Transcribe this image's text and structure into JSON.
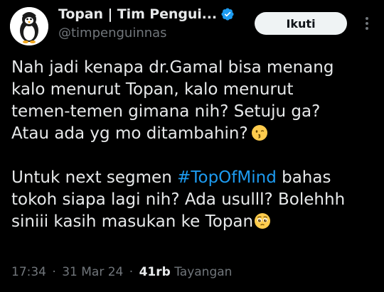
{
  "header": {
    "display_name": "Topan | Tim Pengui...",
    "handle": "@timpenguinnas",
    "follow_label": "Ikuti"
  },
  "tweet": {
    "para1_line1": "Nah jadi kenapa dr.Gamal bisa menang",
    "para1_line2": "kalo menurut Topan, kalo menurut",
    "para1_line3": "temen-temen gimana nih? Setuju ga?",
    "para1_line4": "Atau ada yg mo ditambahin?",
    "para2_line1_pre": "Untuk next segmen",
    "hashtag": "#TopOfMind",
    "para2_line1_post": "bahas",
    "para2_line2": "tokoh siapa lagi nih? Ada usulll? Bolehhh",
    "para2_line3": "siniii kasih masukan ke Topan"
  },
  "meta": {
    "time": "17:34",
    "date": "31 Mar 24",
    "views_count": "41rb",
    "views_label": "Tayangan",
    "separator": "·"
  },
  "colors": {
    "background": "#000000",
    "text": "#e7e9ea",
    "muted": "#71767b",
    "link": "#1d9bf0",
    "verified": "#1d9bf0",
    "button_bg": "#eff3f4"
  },
  "icons": {
    "avatar": "penguin-avatar",
    "verified": "verified-badge-icon",
    "more": "more-dots-icon",
    "emoji1": "kissing-face-emoji",
    "emoji2": "pleading-face-emoji"
  }
}
